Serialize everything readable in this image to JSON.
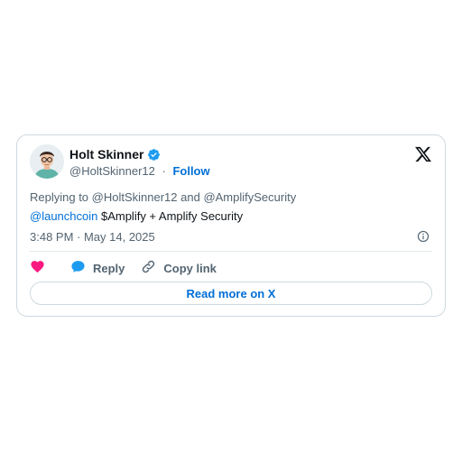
{
  "tweet": {
    "author": {
      "name": "Holt Skinner",
      "handle": "@HoltSkinner12",
      "separator": "·",
      "follow_label": "Follow",
      "verified": true
    },
    "replying_prefix": "Replying to ",
    "replying_user_1": "@HoltSkinner12",
    "replying_and": " and ",
    "replying_user_2": "@AmplifySecurity",
    "body_mention": "@launchcoin",
    "body_rest": " $Amplify + Amplify Security",
    "timestamp": "3:48 PM · May 14, 2025"
  },
  "actions": {
    "like_label": "",
    "reply_label": "Reply",
    "copy_label": "Copy link"
  },
  "read_more_label": "Read more on X",
  "colors": {
    "accent": "#006fd6",
    "like": "#f91880",
    "reply_bubble": "#1d9bf0",
    "muted": "#536471",
    "border": "#cfd9de"
  },
  "icons": [
    "verified-badge-icon",
    "x-logo-icon",
    "info-icon",
    "heart-icon",
    "reply-bubble-icon",
    "link-icon"
  ]
}
